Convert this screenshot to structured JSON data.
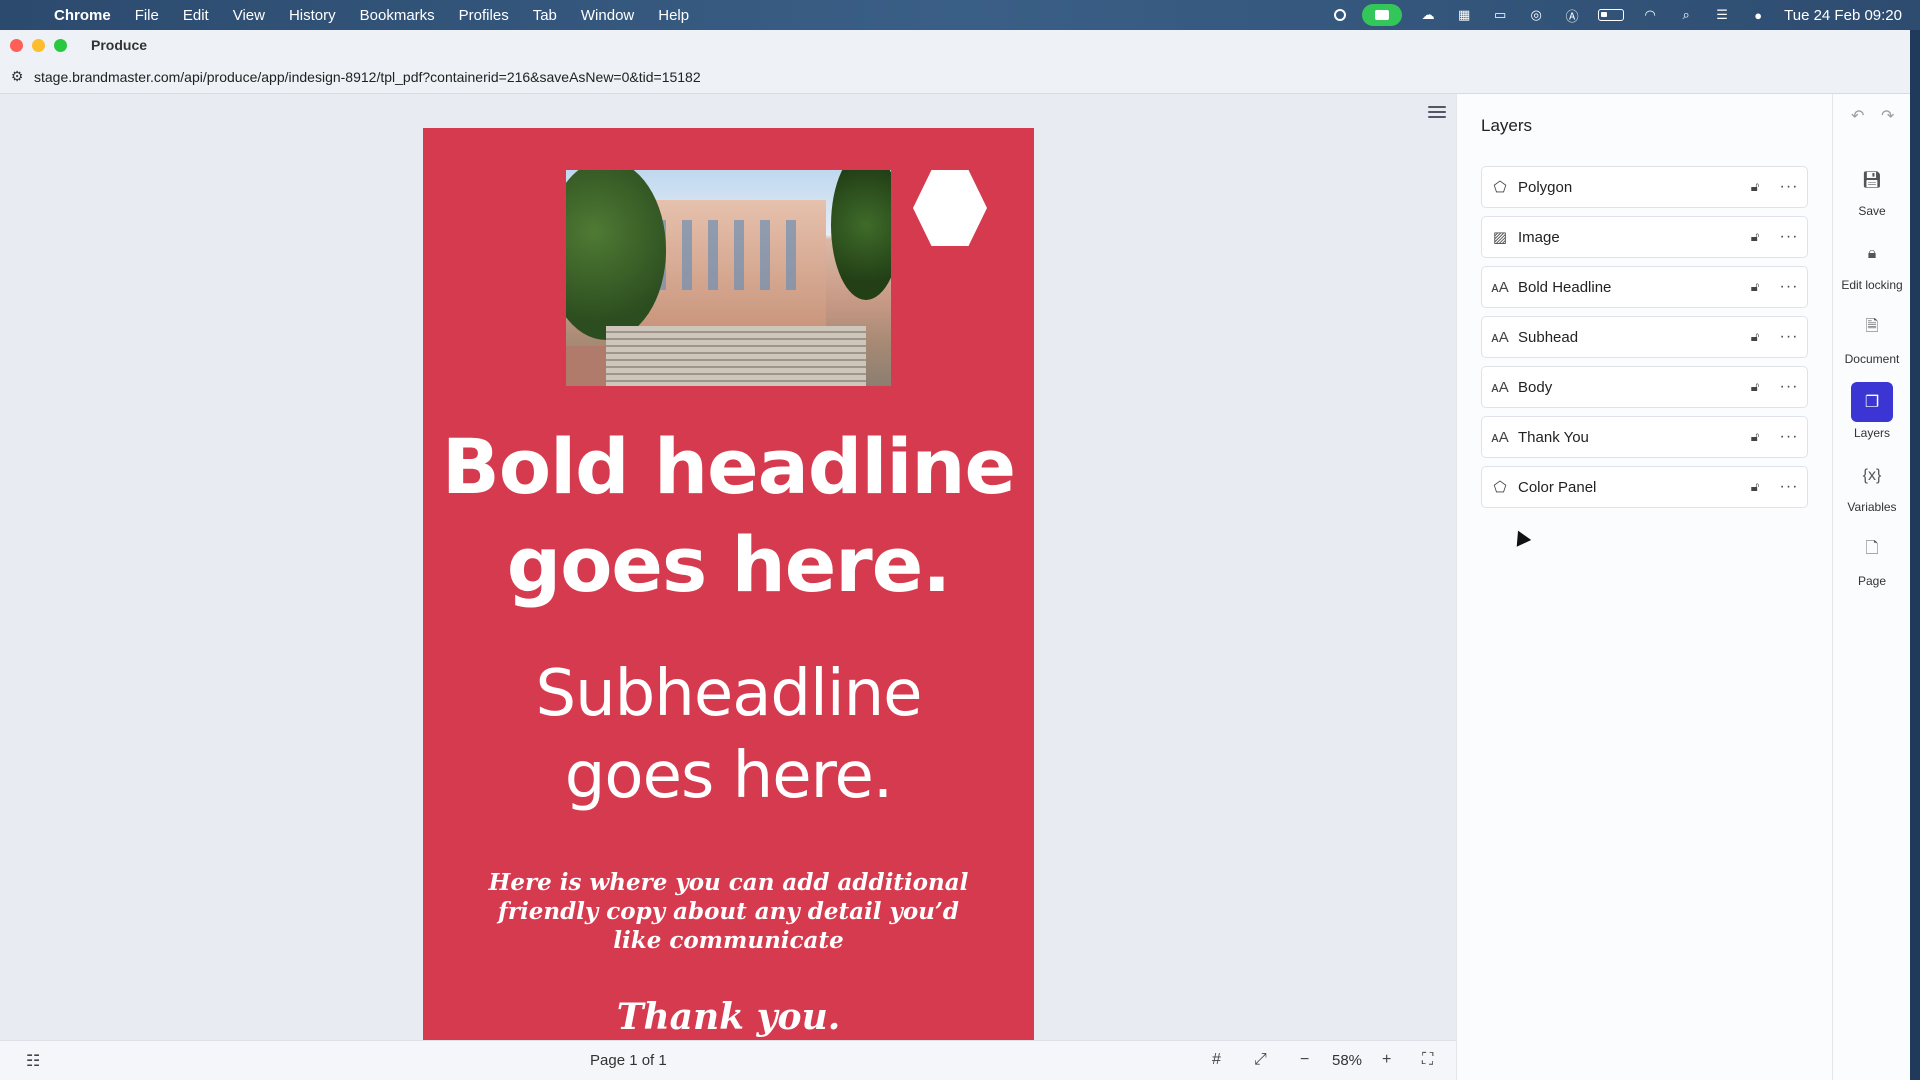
{
  "menubar": {
    "app": "Chrome",
    "items": [
      "File",
      "Edit",
      "View",
      "History",
      "Bookmarks",
      "Profiles",
      "Tab",
      "Window",
      "Help"
    ],
    "datetime": "Tue 24 Feb  09:20"
  },
  "window": {
    "title": "Produce",
    "url": "stage.brandmaster.com/api/produce/app/indesign-8912/tpl_pdf?containerid=216&saveAsNew=0&tid=15182"
  },
  "artboard": {
    "background": "#d63a4e",
    "headline_line1": "Bold headline",
    "headline_line2": "goes here.",
    "subhead_line1": "Subheadline",
    "subhead_line2": "goes here.",
    "body": "Here is where you can add additional friendly copy about any detail you’d like communicate",
    "thanks": "Thank you."
  },
  "statusbar": {
    "page_info": "Page 1 of 1",
    "zoom": "58%"
  },
  "panel": {
    "title": "Layers",
    "layers": [
      {
        "name": "Polygon",
        "icon": "polygon-icon"
      },
      {
        "name": "Image",
        "icon": "image-icon"
      },
      {
        "name": "Bold Headline",
        "icon": "text-icon"
      },
      {
        "name": "Subhead",
        "icon": "text-icon"
      },
      {
        "name": "Body",
        "icon": "text-icon"
      },
      {
        "name": "Thank You",
        "icon": "text-icon"
      },
      {
        "name": "Color Panel",
        "icon": "polygon-icon"
      }
    ]
  },
  "rail": {
    "tools": [
      {
        "label": "Save",
        "icon": "save-icon"
      },
      {
        "label": "Edit locking",
        "icon": "lock-icon"
      },
      {
        "label": "Document",
        "icon": "document-icon"
      },
      {
        "label": "Layers",
        "icon": "layers-icon",
        "active": true
      },
      {
        "label": "Variables",
        "icon": "variables-icon"
      },
      {
        "label": "Page",
        "icon": "page-icon"
      }
    ]
  },
  "accent_color": "#3b35d4"
}
